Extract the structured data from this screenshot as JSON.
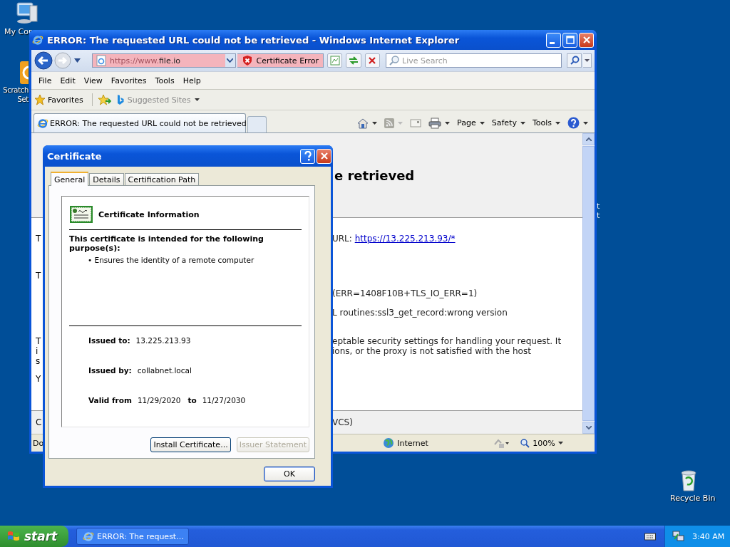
{
  "desktop": {
    "icons": [
      {
        "kind": "computer",
        "lines": [
          "My Cor"
        ]
      },
      {
        "kind": "scratch",
        "lines": [
          "Scratch",
          "Set"
        ]
      },
      {
        "kind": "recycle",
        "lines": [
          "Recycle Bin"
        ]
      }
    ],
    "fragments": [
      "t",
      "t"
    ]
  },
  "browser": {
    "title": "ERROR: The requested URL could not be retrieved - Windows Internet Explorer",
    "address": {
      "prefix": "https://www.",
      "host": "file.io"
    },
    "certificate_error": "Certificate Error",
    "search_placeholder": "Live Search",
    "menu": [
      "File",
      "Edit",
      "View",
      "Favorites",
      "Tools",
      "Help"
    ],
    "favorites": "Favorites",
    "suggested_sites": "Suggested Sites",
    "tab": "ERROR: The requested URL could not be retrieved",
    "commands": [
      "Page",
      "Safety",
      "Tools"
    ],
    "page": {
      "heading": "e retrieved",
      "paragraphs": [
        [
          {
            "left": "T",
            "right": "URL: ",
            "link": "https://13.225.213.93/*"
          }
        ],
        [
          {
            "left": "T"
          }
        ],
        [
          {
            "right": "(ERR=1408F10B+TLS_IO_ERR=1)"
          }
        ],
        [
          {
            "right": "L routines:ssl3_get_record:wrong version"
          }
        ],
        [
          {
            "left": "T",
            "right": "eptable security settings for handling your request. It"
          },
          {
            "left": "i",
            "right": "ions, or the proxy is not satisfied with the host"
          },
          {
            "left": "s"
          }
        ],
        [
          {
            "left": "Y"
          }
        ]
      ],
      "footer": {
        "left": "C",
        "right": "VCS)"
      }
    },
    "status": {
      "left": "Do",
      "zone": "Internet",
      "zoom": "100%"
    }
  },
  "dialog": {
    "title": "Certificate",
    "tabs": [
      {
        "label": "General",
        "selected": true
      },
      {
        "label": "Details",
        "selected": false
      },
      {
        "label": "Certification Path",
        "selected": false
      }
    ],
    "info_title": "Certificate Information",
    "purpose_heading": "This certificate is intended for the following purpose(s):",
    "purposes": [
      "• Ensures the identity of a remote computer"
    ],
    "fields": [
      {
        "label": "Issued to:",
        "value": "13.225.213.93"
      },
      {
        "label": "Issued by:",
        "value": "collabnet.local"
      }
    ],
    "valid": {
      "label": "Valid from",
      "from": "11/29/2020",
      "to_label": "to",
      "to": "11/27/2030"
    },
    "buttons": [
      {
        "label": "Install Certificate...",
        "disabled": false
      },
      {
        "label": "Issuer Statement",
        "disabled": true
      }
    ],
    "ok": "OK"
  },
  "taskbar": {
    "start": "start",
    "tasks": [
      {
        "title": "ERROR: The request...",
        "selected": false
      }
    ],
    "clock": "3:40 AM"
  }
}
